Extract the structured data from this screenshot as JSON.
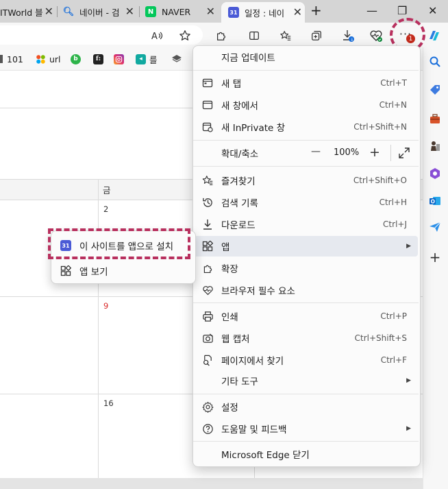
{
  "tabs": [
    {
      "label": "ITWorld 블",
      "icon": "itworld-tab-icon"
    },
    {
      "label": "네이버 - 검",
      "icon": "search-tab-icon"
    },
    {
      "label": "NAVER",
      "icon": "naver-tab-icon",
      "favicon_text": "N"
    },
    {
      "label": "일정 : 네이",
      "icon": "calendar-tab-icon",
      "favicon_text": "31",
      "active": true
    }
  ],
  "window": {
    "new_tab": "+",
    "minimize": "—",
    "restore": "❐",
    "close": "✕"
  },
  "toolbar": {
    "more_badge": "1"
  },
  "bookmarks": [
    {
      "label": "101",
      "icon": "bookmark-101-icon"
    },
    {
      "label": "url",
      "icon": "bookmark-url-icon"
    },
    {
      "label": "",
      "icon": "bookmark-green-icon",
      "favicon_text": "b"
    },
    {
      "label": "",
      "icon": "bookmark-f-icon",
      "favicon_text": "f:"
    },
    {
      "label": "",
      "icon": "bookmark-instagram-icon"
    },
    {
      "label": "를",
      "icon": "bookmark-music-icon"
    },
    {
      "label": "",
      "icon": "bookmark-layers-icon"
    }
  ],
  "calendar": {
    "day_header": "금",
    "dates": [
      "2",
      "9",
      "16"
    ]
  },
  "menu": {
    "update": "지금 업데이트",
    "new_tab": {
      "label": "새 탭",
      "shortcut": "Ctrl+T"
    },
    "new_window": {
      "label": "새 창에서",
      "shortcut": "Ctrl+N"
    },
    "new_inprivate": {
      "label": "새 InPrivate 창",
      "shortcut": "Ctrl+Shift+N"
    },
    "zoom": {
      "label": "확대/축소",
      "minus": "—",
      "value": "100%",
      "plus": "+"
    },
    "favorites": {
      "label": "즐겨찾기",
      "shortcut": "Ctrl+Shift+O"
    },
    "history": {
      "label": "검색 기록",
      "shortcut": "Ctrl+H"
    },
    "downloads": {
      "label": "다운로드",
      "shortcut": "Ctrl+J"
    },
    "apps": {
      "label": "앱"
    },
    "extensions": {
      "label": "확장"
    },
    "essentials": {
      "label": "브라우저 필수 요소"
    },
    "print": {
      "label": "인쇄",
      "shortcut": "Ctrl+P"
    },
    "webcapture": {
      "label": "웹 캡처",
      "shortcut": "Ctrl+Shift+S"
    },
    "find": {
      "label": "페이지에서 찾기",
      "shortcut": "Ctrl+F"
    },
    "more_tools": {
      "label": "기타 도구"
    },
    "settings": {
      "label": "설정"
    },
    "help": {
      "label": "도움말 및 피드백"
    },
    "close_edge": {
      "label": "Microsoft Edge 닫기"
    }
  },
  "submenu": {
    "install": {
      "label": "이 사이트를 앱으로 설치",
      "favicon_text": "31"
    },
    "view_apps": {
      "label": "앱 보기"
    }
  },
  "colors": {
    "accent_annotation": "#b8305e",
    "badge_red": "#c42b1c",
    "weekend_red": "#d92b2b",
    "calendar_blue": "#4a5ad6"
  }
}
